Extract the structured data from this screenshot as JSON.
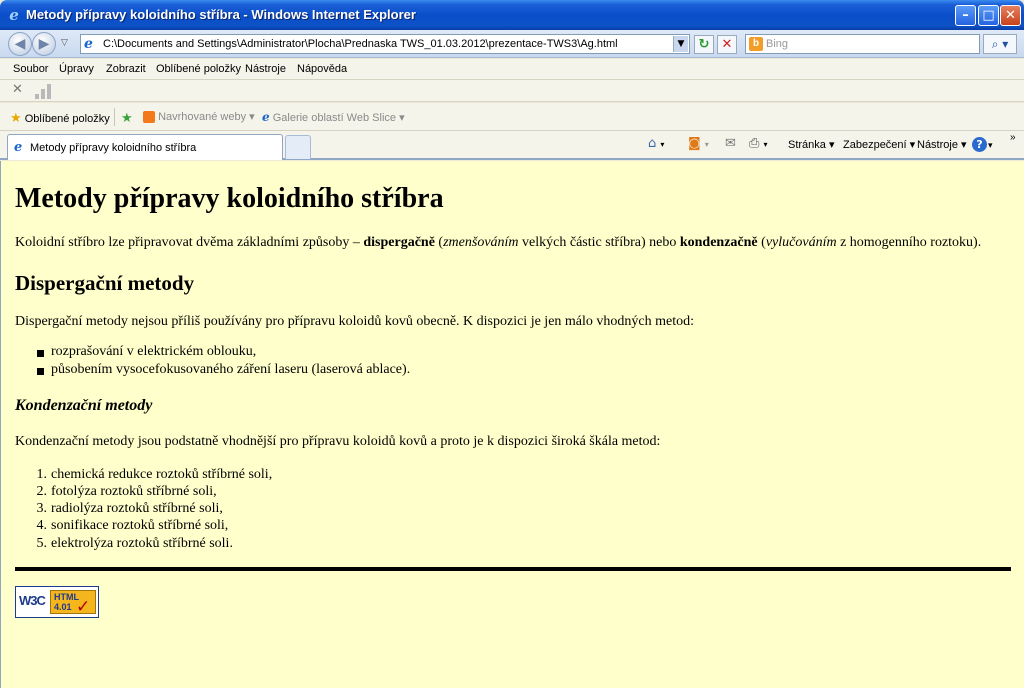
{
  "window": {
    "title": "Metody přípravy koloidního stříbra - Windows Internet Explorer"
  },
  "address_bar": {
    "url": "C:\\Documents and Settings\\Administrator\\Plocha\\Prednaska TWS_01.03.2012\\prezentace-TWS3\\Ag.html",
    "search_placeholder": "Bing"
  },
  "menu": {
    "items": [
      "Soubor",
      "Úpravy",
      "Zobrazit",
      "Oblíbené položky",
      "Nástroje",
      "Nápověda"
    ]
  },
  "favorites_bar": {
    "favorites_label": "Oblíbené položky",
    "suggested_sites": "Navrhované weby",
    "web_slice_gallery": "Galerie oblastí Web Slice"
  },
  "tabs": {
    "active_label": "Metody přípravy koloidního stříbra"
  },
  "command_bar": {
    "page": "Stránka",
    "safety": "Zabezpečení",
    "tools": "Nástroje"
  },
  "document": {
    "title": "Metody přípravy koloidního stříbra",
    "intro": {
      "t1": "Koloidní stříbro lze připravovat dvěma základními způsoby – ",
      "b1": "dispergačně",
      "t2": " (",
      "i1": "zmenšováním",
      "t3": " velkých částic stříbra) nebo ",
      "b2": "kondenzačně",
      "t4": " (",
      "i2": "vylučováním",
      "t5": " z homogenního roztoku)."
    },
    "h2_dispersion": "Dispergační metody",
    "p_dispersion": "Dispergační metody nejsou příliš používány pro přípravu koloidů kovů obecně. K dispozici je jen málo vhodných metod:",
    "dispersion_methods": [
      "rozprašování v elektrickém oblouku,",
      "působením vysocefokusovaného záření laseru (laserová ablace)."
    ],
    "h3_condensation": "Kondenzační metody",
    "p_condensation": "Kondenzační metody jsou podstatně vhodnější pro přípravu koloidů kovů a proto je k dispozici široká škála metod:",
    "condensation_methods": [
      "chemická redukce roztoků stříbrné soli,",
      "fotolýza roztoků stříbrné soli,",
      "radiolýza roztoků stříbrné soli,",
      "sonifikace roztoků stříbrné soli,",
      "elektrolýza roztoků stříbrné soli."
    ],
    "badge": {
      "w3c": "W3C",
      "html": "HTML",
      "version": "4.01"
    }
  }
}
